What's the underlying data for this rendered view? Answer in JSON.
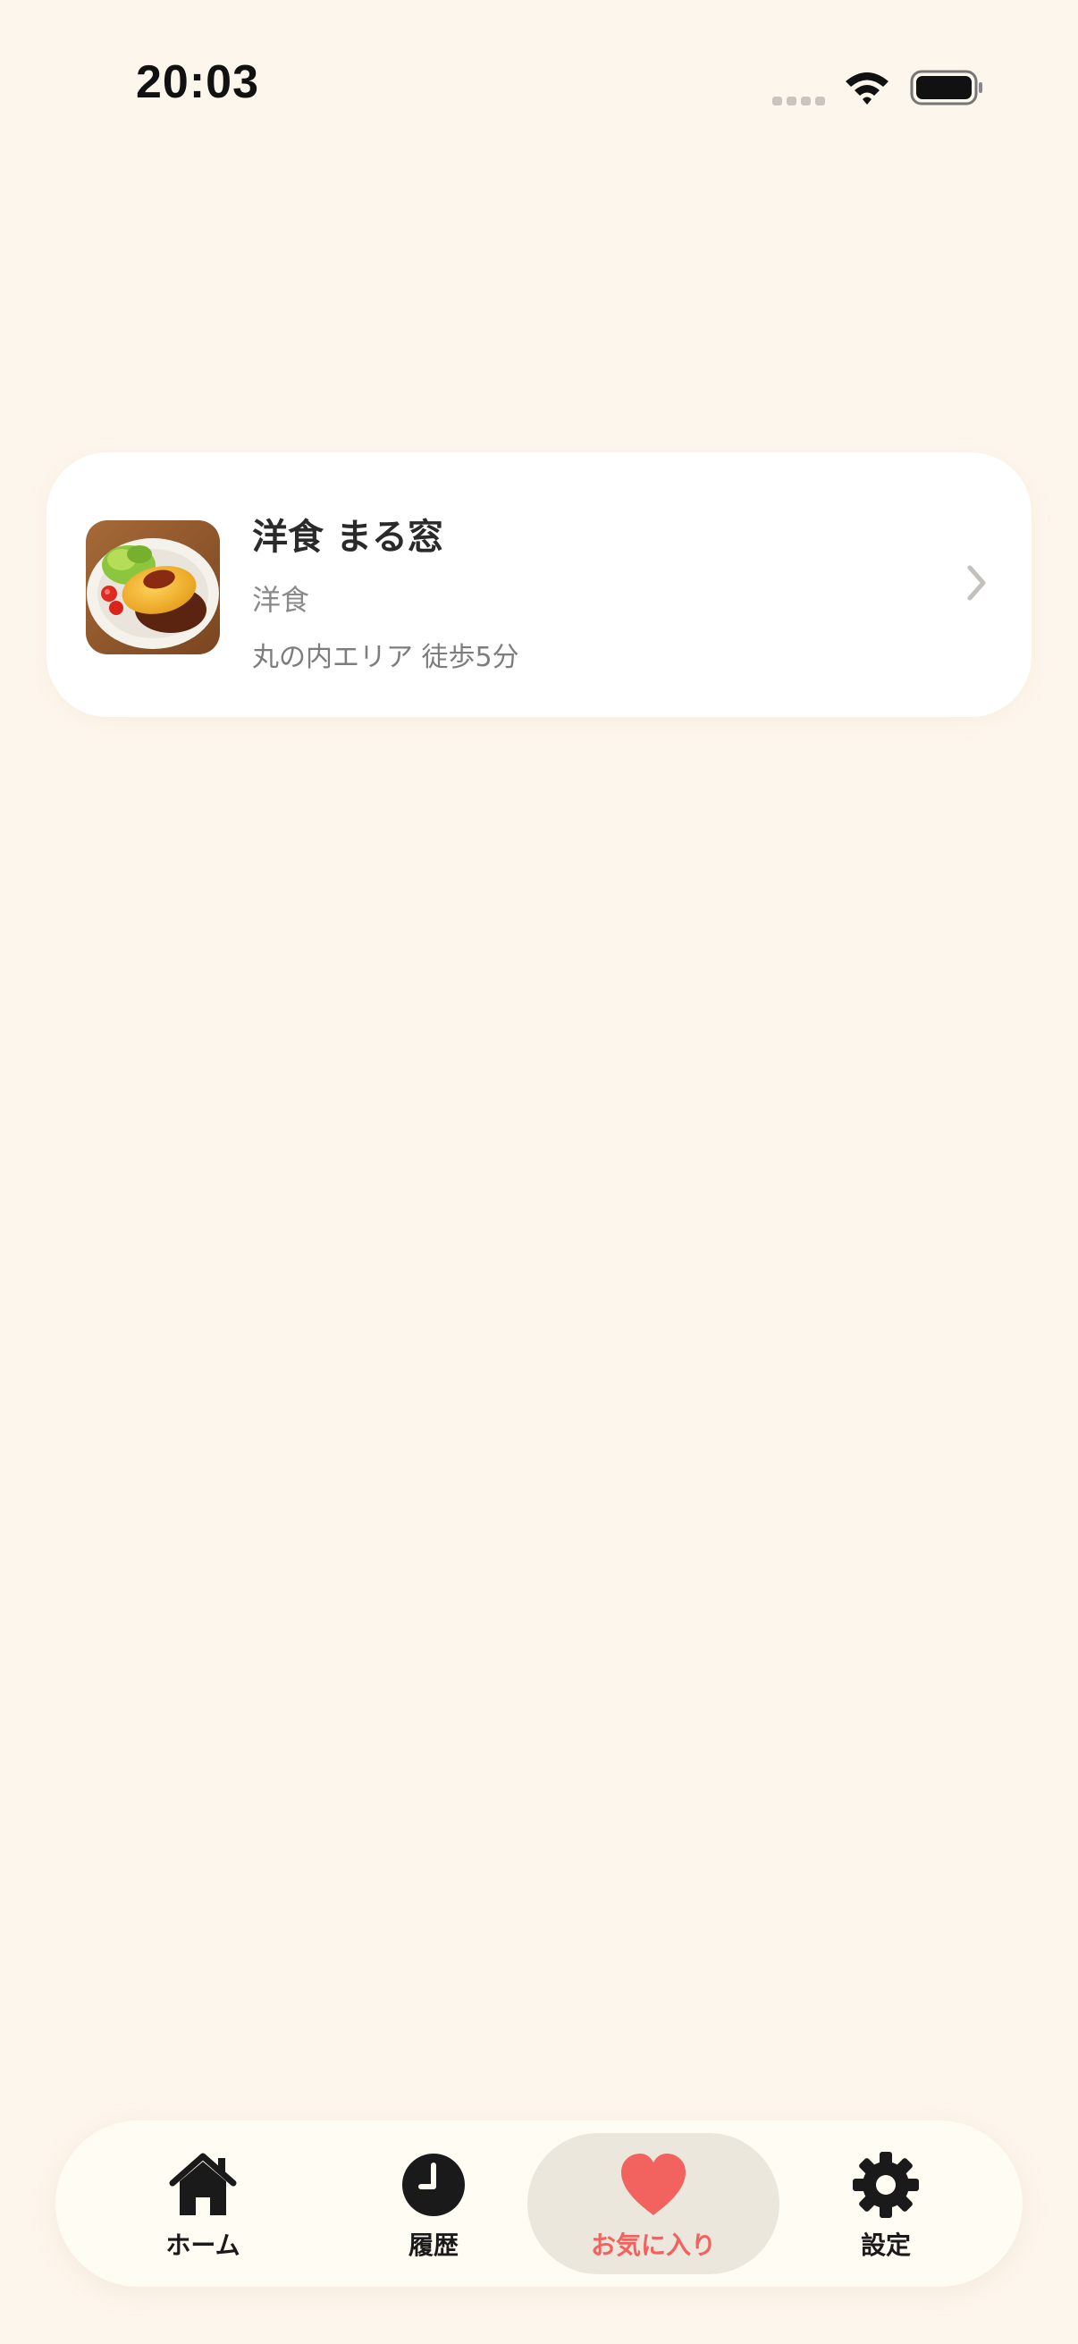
{
  "status_bar": {
    "time": "20:03"
  },
  "favorites": [
    {
      "name": "洋食 まる窓",
      "category": "洋食",
      "location": "丸の内エリア 徒歩5分",
      "thumbnail_icon": "omurice-photo"
    }
  ],
  "tab_bar": {
    "active_color": "#f2625e",
    "tabs": [
      {
        "label": "ホーム",
        "icon": "home-icon"
      },
      {
        "label": "履歴",
        "icon": "clock-icon"
      },
      {
        "label": "お気に入り",
        "icon": "heart-icon",
        "active": true
      },
      {
        "label": "設定",
        "icon": "gear-icon"
      }
    ]
  }
}
